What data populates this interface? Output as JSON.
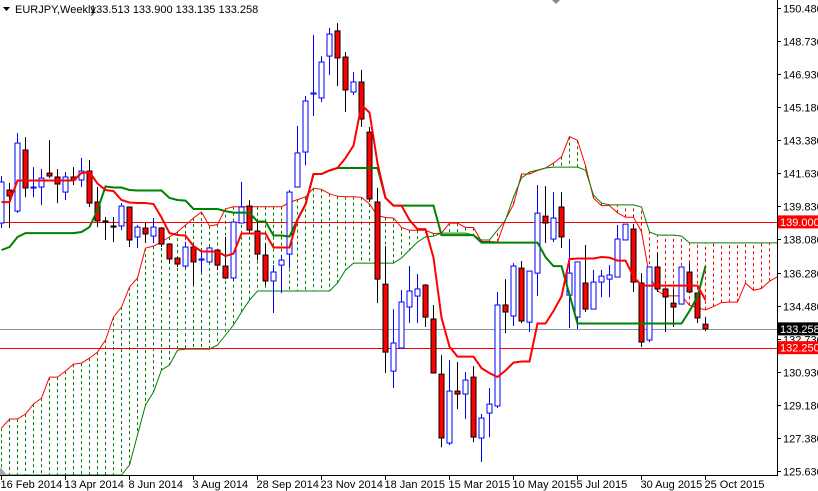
{
  "header": {
    "symbol_label": "EURJPY,Weekly",
    "ohlc_label": "133.513 133.900 133.135 133.258",
    "menu_icon": "triangle-down-icon"
  },
  "colors": {
    "bull_outline": "#0000FF",
    "bear_fill": "#FF0000",
    "bear_outline": "#000000",
    "tenkan": "#FF0000",
    "kijun": "#008000",
    "span_a": "#FF0000",
    "span_b": "#008000",
    "level_line": "#FF0000",
    "bid_line": "#8C96A0",
    "bid_label_bg": "#000000",
    "level_label_bg": "#FF0000"
  },
  "chart_data": {
    "type": "candlestick",
    "title": "EURJPY,Weekly",
    "ylim": [
      125.63,
      150.48
    ],
    "grid": false,
    "y_ticks": [
      "150.480",
      "148.730",
      "146.930",
      "145.180",
      "143.380",
      "141.630",
      "139.830",
      "138.080",
      "136.280",
      "134.480",
      "132.730",
      "130.930",
      "129.180",
      "127.380",
      "125.630"
    ],
    "x_labels": [
      {
        "index": 0,
        "label": "16 Feb 2014"
      },
      {
        "index": 8,
        "label": "13 Apr 2014"
      },
      {
        "index": 16,
        "label": "8 Jun 2014"
      },
      {
        "index": 24,
        "label": "3 Aug 2014"
      },
      {
        "index": 32,
        "label": "28 Sep 2014"
      },
      {
        "index": 40,
        "label": "23 Nov 2014"
      },
      {
        "index": 48,
        "label": "18 Jan 2015"
      },
      {
        "index": 56,
        "label": "15 Mar 2015"
      },
      {
        "index": 64,
        "label": "10 May 2015"
      },
      {
        "index": 72,
        "label": "5 Jul 2015"
      },
      {
        "index": 80,
        "label": "30 Aug 2015"
      },
      {
        "index": 88,
        "label": "25 Oct 2015"
      }
    ],
    "levels": [
      {
        "name": "resistance",
        "value": 139.0,
        "label": "139.000"
      },
      {
        "name": "support",
        "value": 132.25,
        "label": "132.250"
      }
    ],
    "bid": {
      "value": 133.258,
      "label": "133.258"
    },
    "candles_ohlc": [
      [
        138.94,
        141.46,
        138.67,
        141.14
      ],
      [
        140.71,
        141.09,
        138.67,
        140.39
      ],
      [
        139.58,
        143.77,
        139.48,
        143.23
      ],
      [
        142.86,
        143.55,
        140.33,
        140.82
      ],
      [
        140.82,
        141.94,
        140.33,
        140.87
      ],
      [
        140.87,
        141.84,
        139.91,
        141.35
      ],
      [
        141.62,
        143.39,
        141.35,
        141.46
      ],
      [
        141.41,
        141.84,
        140.01,
        141.03
      ],
      [
        140.6,
        141.68,
        140.17,
        141.41
      ],
      [
        141.41,
        141.94,
        140.98,
        141.25
      ],
      [
        141.25,
        142.43,
        140.87,
        141.73
      ],
      [
        141.73,
        142.32,
        139.8,
        140.01
      ],
      [
        140.07,
        140.87,
        138.72,
        139.05
      ],
      [
        139.05,
        139.26,
        138.03,
        138.99
      ],
      [
        138.78,
        139.26,
        137.92,
        138.72
      ],
      [
        138.78,
        140.01,
        138.56,
        139.85
      ],
      [
        139.8,
        139.8,
        137.65,
        138.03
      ],
      [
        138.19,
        138.83,
        137.6,
        138.72
      ],
      [
        138.67,
        138.94,
        137.87,
        138.35
      ],
      [
        138.24,
        139.21,
        137.87,
        138.72
      ],
      [
        138.67,
        138.72,
        137.65,
        137.81
      ],
      [
        137.81,
        137.81,
        136.79,
        137.01
      ],
      [
        137.06,
        137.06,
        136.58,
        136.74
      ],
      [
        136.63,
        137.92,
        136.52,
        137.65
      ],
      [
        137.65,
        137.65,
        135.61,
        136.85
      ],
      [
        136.95,
        137.38,
        136.31,
        137.01
      ],
      [
        136.85,
        137.65,
        136.79,
        137.6
      ],
      [
        137.49,
        137.49,
        136.42,
        136.68
      ],
      [
        136.63,
        138.19,
        135.93,
        135.99
      ],
      [
        135.99,
        138.99,
        135.88,
        138.99
      ],
      [
        138.94,
        141.14,
        138.94,
        139.8
      ],
      [
        139.85,
        140.17,
        138.4,
        138.56
      ],
      [
        138.51,
        139.05,
        136.95,
        137.27
      ],
      [
        137.22,
        137.87,
        135.61,
        135.83
      ],
      [
        135.83,
        136.68,
        134.11,
        136.31
      ],
      [
        136.68,
        137.22,
        135.18,
        136.95
      ],
      [
        137.27,
        140.71,
        136.52,
        140.6
      ],
      [
        140.87,
        144.15,
        140.87,
        142.7
      ],
      [
        142.75,
        145.76,
        142.05,
        145.49
      ],
      [
        145.86,
        149.03,
        144.68,
        145.92
      ],
      [
        145.65,
        147.9,
        145.43,
        147.58
      ],
      [
        147.9,
        149.41,
        146.88,
        149.08
      ],
      [
        149.25,
        149.67,
        146.29,
        147.8
      ],
      [
        147.85,
        148.12,
        144.9,
        146.08
      ],
      [
        145.97,
        147.04,
        145.81,
        146.51
      ],
      [
        146.51,
        147.15,
        144.09,
        144.52
      ],
      [
        143.82,
        144.09,
        140.07,
        140.23
      ],
      [
        140.07,
        140.82,
        134.64,
        135.93
      ],
      [
        135.66,
        137.7,
        130.89,
        132.01
      ],
      [
        130.99,
        134.32,
        130.08,
        132.5
      ],
      [
        132.23,
        135.34,
        132.23,
        134.7
      ],
      [
        134.43,
        136.63,
        133.57,
        135.29
      ],
      [
        135.02,
        136.2,
        133.57,
        135.4
      ],
      [
        135.61,
        135.66,
        133.36,
        133.89
      ],
      [
        133.79,
        134.54,
        130.89,
        130.89
      ],
      [
        130.83,
        131.85,
        126.91,
        127.4
      ],
      [
        127.13,
        131.58,
        127.02,
        129.92
      ],
      [
        129.92,
        131.48,
        128.95,
        129.76
      ],
      [
        129.76,
        130.94,
        128.42,
        130.51
      ],
      [
        130.67,
        131.26,
        127.18,
        127.45
      ],
      [
        127.4,
        128.69,
        126.11,
        128.47
      ],
      [
        128.74,
        130.08,
        127.45,
        129.22
      ],
      [
        129.12,
        135.24,
        129.01,
        134.54
      ],
      [
        134.54,
        135.93,
        133.03,
        134.16
      ],
      [
        133.95,
        136.79,
        133.41,
        136.63
      ],
      [
        136.52,
        136.9,
        133.57,
        133.68
      ],
      [
        133.62,
        136.36,
        133.09,
        136.36
      ],
      [
        136.25,
        140.98,
        135.02,
        139.47
      ],
      [
        139.31,
        140.92,
        137.87,
        138.94
      ],
      [
        138.08,
        140.6,
        137.92,
        139.21
      ],
      [
        139.8,
        140.6,
        137.6,
        138.19
      ],
      [
        135.07,
        138.08,
        133.3,
        136.25
      ],
      [
        133.89,
        136.85,
        133.25,
        136.85
      ],
      [
        135.72,
        137.76,
        134.16,
        134.32
      ],
      [
        134.32,
        136.42,
        134.32,
        135.77
      ],
      [
        135.77,
        136.42,
        134.96,
        136.09
      ],
      [
        135.93,
        136.68,
        134.96,
        136.15
      ],
      [
        136.04,
        138.83,
        136.04,
        138.08
      ],
      [
        138.03,
        138.88,
        138.03,
        138.88
      ],
      [
        138.62,
        138.88,
        135.24,
        135.77
      ],
      [
        135.72,
        136.25,
        132.28,
        132.55
      ],
      [
        132.66,
        136.58,
        132.55,
        136.58
      ],
      [
        136.58,
        137.33,
        135.24,
        135.4
      ],
      [
        135.4,
        135.4,
        133.09,
        134.97
      ],
      [
        134.64,
        135.4,
        133.36,
        134.43
      ],
      [
        134.59,
        136.58,
        134.59,
        136.58
      ],
      [
        136.31,
        136.79,
        135.18,
        135.24
      ],
      [
        135.18,
        135.18,
        133.57,
        133.84
      ],
      [
        133.513,
        133.9,
        133.135,
        133.258
      ]
    ],
    "ichimoku": {
      "tenkan_period": 9,
      "kijun_period": 26,
      "shift": 26,
      "kijun_prefix": [
        137.49,
        137.65,
        138.19,
        138.4,
        138.4,
        138.4,
        138.4,
        138.4,
        138.4,
        138.4,
        138.46,
        138.72,
        139.64
      ],
      "span_a_prefix": [
        127.93,
        128.42,
        128.42,
        128.69,
        129.22,
        129.54,
        130.67,
        130.67,
        130.99,
        131.37,
        131.42,
        131.69,
        132.01,
        132.66,
        133.89,
        134.43,
        135.5,
        135.99,
        137.6,
        137.7,
        137.92,
        138.19,
        138.46,
        138.83,
        139.21,
        139.53
      ],
      "span_b": [
        119.5,
        119.8,
        120.1,
        120.4,
        120.7,
        121.0,
        121.3,
        121.6,
        121.9,
        122.2,
        122.5,
        122.8,
        123.1,
        123.4,
        123.8,
        124.87,
        125.95,
        127.56,
        129.17,
        129.87,
        131.05,
        131.32,
        132.12,
        132.17,
        132.17,
        132.17,
        132.17,
        132.39,
        132.93,
        133.46,
        134.16,
        134.8,
        135.29,
        135.29,
        135.29,
        135.29,
        135.29,
        135.29,
        135.29,
        135.29,
        135.29,
        135.29,
        135.72,
        136.42,
        136.79,
        136.79,
        136.79,
        136.79,
        136.79,
        136.79,
        137.06,
        137.49,
        137.92,
        138.19,
        138.24,
        138.4,
        138.4,
        138.4,
        138.4,
        138.29,
        138.03,
        138.03,
        138.56,
        139.1,
        140.33,
        141.35,
        141.68,
        141.78,
        141.89,
        141.94,
        141.94,
        141.94,
        141.94,
        141.78,
        140.44,
        140.01,
        139.91,
        139.91,
        139.91,
        139.91,
        139.8,
        138.46,
        138.29,
        138.29,
        138.29,
        138.24,
        137.87,
        137.87,
        137.87,
        137.87,
        137.87,
        137.87,
        137.87,
        137.87,
        137.87,
        137.87,
        137.87,
        137.87
      ]
    }
  }
}
